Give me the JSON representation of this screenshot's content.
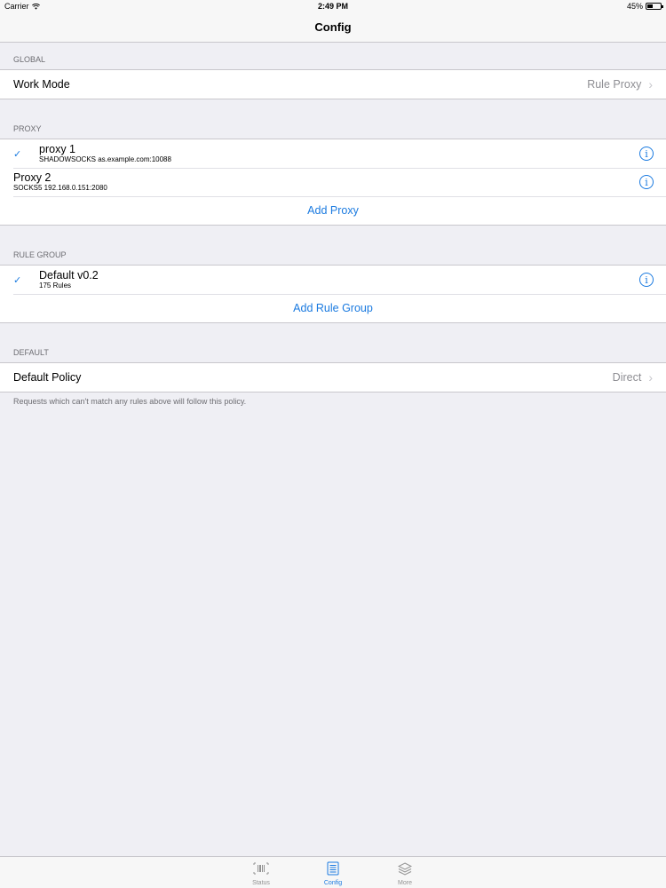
{
  "status_bar": {
    "carrier": "Carrier",
    "time": "2:49 PM",
    "battery": "45%",
    "battery_level": 0.45
  },
  "nav": {
    "title": "Config"
  },
  "sections": {
    "global": {
      "header": "GLOBAL",
      "work_mode": {
        "title": "Work Mode",
        "value": "Rule Proxy"
      }
    },
    "proxy": {
      "header": "PROXY",
      "items": [
        {
          "name": "proxy 1",
          "detail": "SHADOWSOCKS as.example.com:10088",
          "selected": true
        },
        {
          "name": "Proxy 2",
          "detail": "SOCKS5 192.168.0.151:2080",
          "selected": false
        }
      ],
      "add_label": "Add Proxy"
    },
    "rule_group": {
      "header": "RULE GROUP",
      "items": [
        {
          "name": "Default v0.2",
          "detail": "175 Rules",
          "selected": true
        }
      ],
      "add_label": "Add Rule Group"
    },
    "default": {
      "header": "DEFAULT",
      "policy": {
        "title": "Default Policy",
        "value": "Direct"
      },
      "footer": "Requests which can't match any rules above will follow this policy."
    }
  },
  "tabs": [
    {
      "label": "Status",
      "icon": "barcode-icon",
      "active": false
    },
    {
      "label": "Config",
      "icon": "list-icon",
      "active": true
    },
    {
      "label": "More",
      "icon": "layers-icon",
      "active": false
    }
  ],
  "colors": {
    "accent": "#1a7ae0",
    "background": "#efeff4",
    "secondary_text": "#8e8e93"
  }
}
